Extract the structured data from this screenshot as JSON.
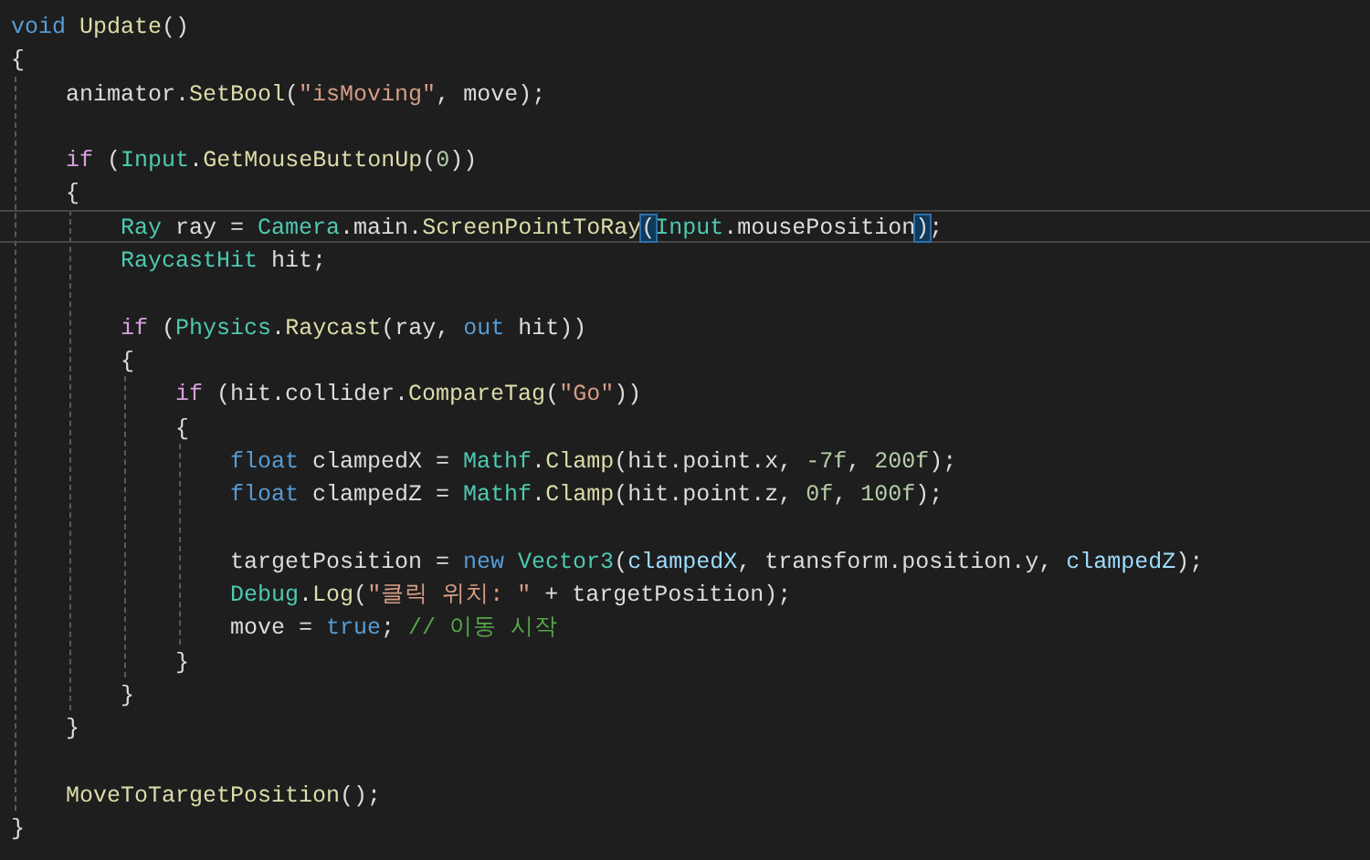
{
  "editor": {
    "lines": [
      {
        "tokens": [
          {
            "text": "void ",
            "kind": "keyword"
          },
          {
            "text": "Update",
            "kind": "method"
          },
          {
            "text": "()",
            "kind": "plain"
          }
        ]
      },
      {
        "tokens": [
          {
            "text": "{",
            "kind": "plain"
          }
        ],
        "children": [
          {
            "tokens": [
              {
                "text": "animator.",
                "kind": "plain"
              },
              {
                "text": "SetBool",
                "kind": "method"
              },
              {
                "text": "(",
                "kind": "plain"
              },
              {
                "text": "\"isMoving\"",
                "kind": "string"
              },
              {
                "text": ", move);",
                "kind": "plain"
              }
            ]
          },
          {
            "gap_before": true,
            "tokens": [
              {
                "text": "if",
                "kind": "control"
              },
              {
                "text": " (",
                "kind": "plain"
              },
              {
                "text": "Input",
                "kind": "type"
              },
              {
                "text": ".",
                "kind": "plain"
              },
              {
                "text": "GetMouseButtonUp",
                "kind": "method"
              },
              {
                "text": "(",
                "kind": "plain"
              },
              {
                "text": "0",
                "kind": "number"
              },
              {
                "text": "))",
                "kind": "plain"
              }
            ]
          },
          {
            "tokens": [
              {
                "text": "{",
                "kind": "plain"
              }
            ],
            "children": [
              {
                "current": true,
                "tokens": [
                  {
                    "text": "Ray",
                    "kind": "type"
                  },
                  {
                    "text": " ray = ",
                    "kind": "plain"
                  },
                  {
                    "text": "Camera",
                    "kind": "type"
                  },
                  {
                    "text": ".main.",
                    "kind": "plain"
                  },
                  {
                    "text": "ScreenPointToRay",
                    "kind": "method"
                  },
                  {
                    "text": "(",
                    "kind": "match"
                  },
                  {
                    "text": "Input",
                    "kind": "type"
                  },
                  {
                    "text": ".mousePosition",
                    "kind": "plain"
                  },
                  {
                    "text": ")",
                    "kind": "match"
                  },
                  {
                    "text": ";",
                    "kind": "plain"
                  }
                ]
              },
              {
                "tokens": [
                  {
                    "text": "RaycastHit",
                    "kind": "type"
                  },
                  {
                    "text": " hit;",
                    "kind": "plain"
                  }
                ]
              },
              {
                "gap_before": true,
                "tokens": [
                  {
                    "text": "if",
                    "kind": "control"
                  },
                  {
                    "text": " (",
                    "kind": "plain"
                  },
                  {
                    "text": "Physics",
                    "kind": "type"
                  },
                  {
                    "text": ".",
                    "kind": "plain"
                  },
                  {
                    "text": "Raycast",
                    "kind": "method"
                  },
                  {
                    "text": "(ray, ",
                    "kind": "plain"
                  },
                  {
                    "text": "out",
                    "kind": "keyword"
                  },
                  {
                    "text": " hit))",
                    "kind": "plain"
                  }
                ]
              },
              {
                "tokens": [
                  {
                    "text": "{",
                    "kind": "plain"
                  }
                ],
                "children": [
                  {
                    "tokens": [
                      {
                        "text": "if",
                        "kind": "control"
                      },
                      {
                        "text": " (hit.collider.",
                        "kind": "plain"
                      },
                      {
                        "text": "CompareTag",
                        "kind": "method"
                      },
                      {
                        "text": "(",
                        "kind": "plain"
                      },
                      {
                        "text": "\"Go\"",
                        "kind": "string"
                      },
                      {
                        "text": "))",
                        "kind": "plain"
                      }
                    ]
                  },
                  {
                    "tokens": [
                      {
                        "text": "{",
                        "kind": "plain"
                      }
                    ],
                    "children": [
                      {
                        "tokens": [
                          {
                            "text": "float",
                            "kind": "keyword"
                          },
                          {
                            "text": " clampedX = ",
                            "kind": "plain"
                          },
                          {
                            "text": "Mathf",
                            "kind": "type"
                          },
                          {
                            "text": ".",
                            "kind": "plain"
                          },
                          {
                            "text": "Clamp",
                            "kind": "method"
                          },
                          {
                            "text": "(hit.point.x, ",
                            "kind": "plain"
                          },
                          {
                            "text": "-7f",
                            "kind": "number"
                          },
                          {
                            "text": ", ",
                            "kind": "plain"
                          },
                          {
                            "text": "200f",
                            "kind": "number"
                          },
                          {
                            "text": ");",
                            "kind": "plain"
                          }
                        ]
                      },
                      {
                        "tokens": [
                          {
                            "text": "float",
                            "kind": "keyword"
                          },
                          {
                            "text": " clampedZ = ",
                            "kind": "plain"
                          },
                          {
                            "text": "Mathf",
                            "kind": "type"
                          },
                          {
                            "text": ".",
                            "kind": "plain"
                          },
                          {
                            "text": "Clamp",
                            "kind": "method"
                          },
                          {
                            "text": "(hit.point.z, ",
                            "kind": "plain"
                          },
                          {
                            "text": "0f",
                            "kind": "number"
                          },
                          {
                            "text": ", ",
                            "kind": "plain"
                          },
                          {
                            "text": "100f",
                            "kind": "number"
                          },
                          {
                            "text": ");",
                            "kind": "plain"
                          }
                        ]
                      },
                      {
                        "gap_before": true,
                        "tokens": [
                          {
                            "text": "targetPosition = ",
                            "kind": "plain"
                          },
                          {
                            "text": "new ",
                            "kind": "keyword"
                          },
                          {
                            "text": "Vector3",
                            "kind": "type"
                          },
                          {
                            "text": "(",
                            "kind": "plain"
                          },
                          {
                            "text": "clampedX",
                            "kind": "local"
                          },
                          {
                            "text": ", transform.position.y, ",
                            "kind": "plain"
                          },
                          {
                            "text": "clampedZ",
                            "kind": "local"
                          },
                          {
                            "text": ");",
                            "kind": "plain"
                          }
                        ]
                      },
                      {
                        "tokens": [
                          {
                            "text": "Debug",
                            "kind": "type"
                          },
                          {
                            "text": ".",
                            "kind": "plain"
                          },
                          {
                            "text": "Log",
                            "kind": "method"
                          },
                          {
                            "text": "(",
                            "kind": "plain"
                          },
                          {
                            "text": "\"클릭 위치: \"",
                            "kind": "string"
                          },
                          {
                            "text": " + targetPosition);",
                            "kind": "plain"
                          }
                        ]
                      },
                      {
                        "tokens": [
                          {
                            "text": "move = ",
                            "kind": "plain"
                          },
                          {
                            "text": "true",
                            "kind": "keyword"
                          },
                          {
                            "text": "; ",
                            "kind": "plain"
                          },
                          {
                            "text": "// 이동 시작",
                            "kind": "comment"
                          }
                        ]
                      }
                    ]
                  },
                  {
                    "tokens": [
                      {
                        "text": "}",
                        "kind": "plain"
                      }
                    ]
                  }
                ]
              },
              {
                "tokens": [
                  {
                    "text": "}",
                    "kind": "plain"
                  }
                ]
              }
            ]
          },
          {
            "tokens": [
              {
                "text": "}",
                "kind": "plain"
              }
            ]
          },
          {
            "gap_before": true,
            "tokens": [
              {
                "text": "MoveToTargetPosition",
                "kind": "method"
              },
              {
                "text": "();",
                "kind": "plain"
              }
            ]
          }
        ]
      },
      {
        "tokens": [
          {
            "text": "}",
            "kind": "plain"
          }
        ]
      }
    ]
  }
}
